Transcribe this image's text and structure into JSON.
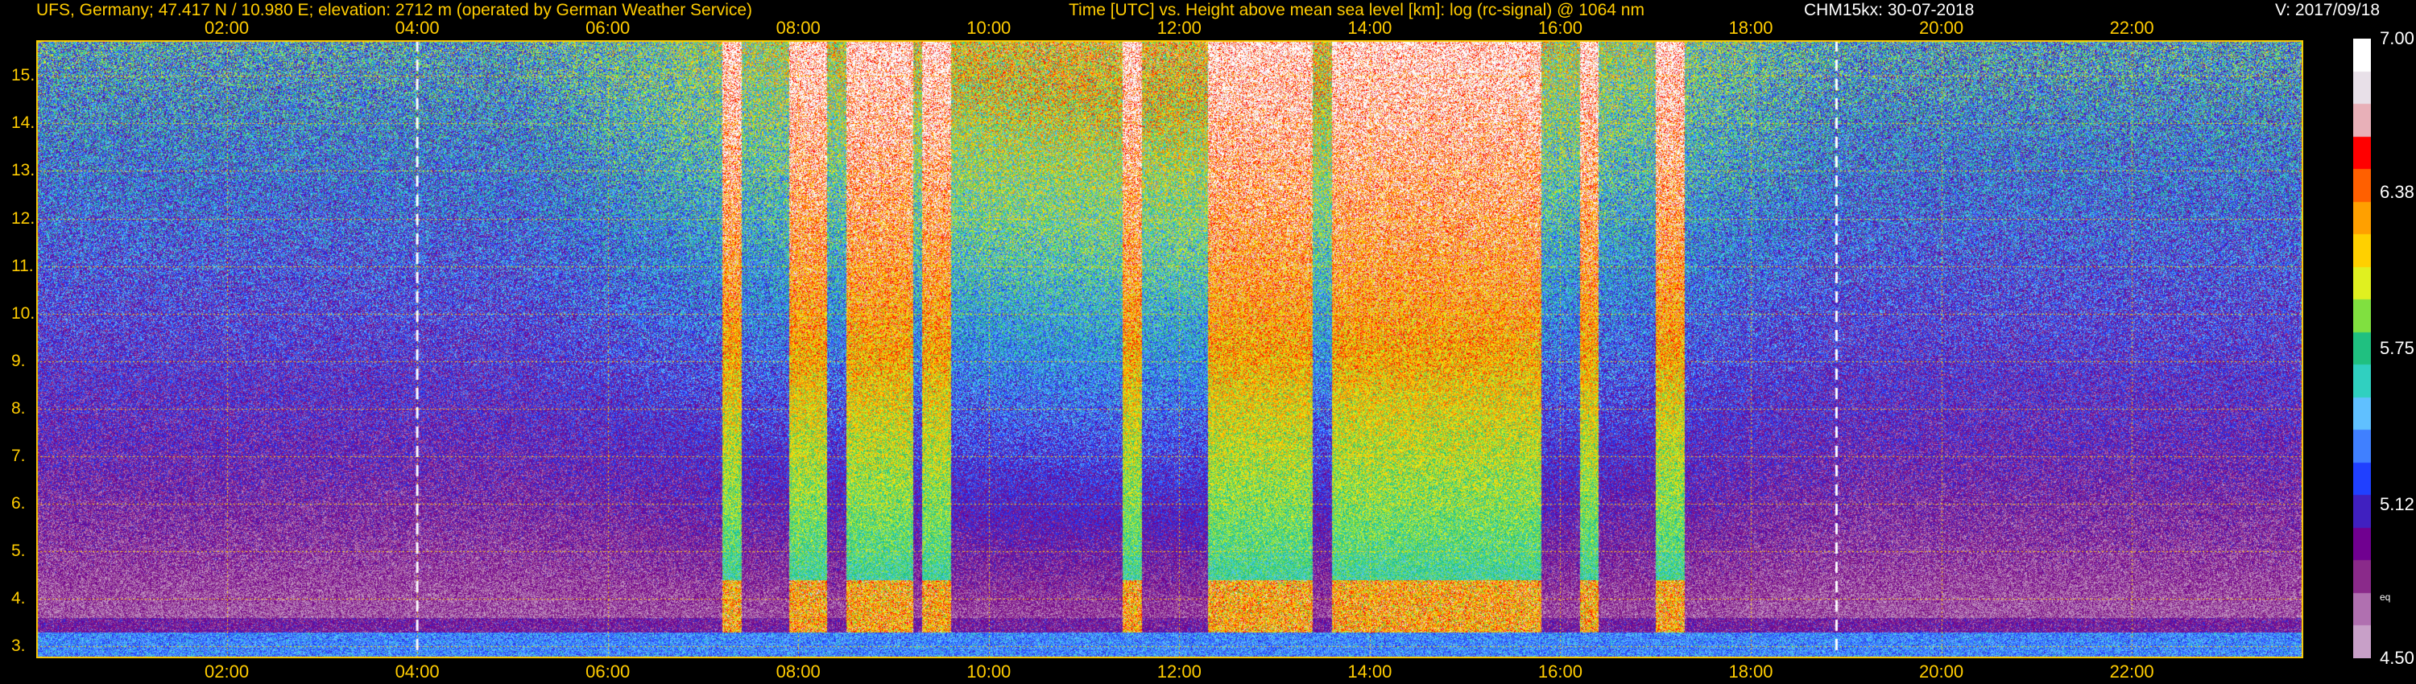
{
  "header": {
    "site": "UFS, Germany; 47.417 N / 10.980 E; elevation: 2712 m  (operated by German Weather Service)",
    "title": "Time [UTC] vs. Height above mean sea level [km]: log (rc-signal) @ 1064 nm",
    "instrument": "CHM15kx: 30-07-2018",
    "version": "V: 2017/09/18"
  },
  "chart_data": {
    "type": "heatmap",
    "title": "Time [UTC] vs. Height above mean sea level [km]: log (rc-signal) @ 1064 nm",
    "x_ticks": [
      "02:00",
      "04:00",
      "06:00",
      "08:00",
      "10:00",
      "12:00",
      "14:00",
      "16:00",
      "18:00",
      "20:00",
      "22:00"
    ],
    "x_tick_hours": [
      2,
      4,
      6,
      8,
      10,
      12,
      14,
      16,
      18,
      20,
      22
    ],
    "xlim_hours": [
      0.0,
      23.8
    ],
    "y_ticks": [
      "3.",
      "4.",
      "5.",
      "6.",
      "7.",
      "8.",
      "9.",
      "10.",
      "11.",
      "12.",
      "13.",
      "14.",
      "15."
    ],
    "y_tick_values": [
      3,
      4,
      5,
      6,
      7,
      8,
      9,
      10,
      11,
      12,
      13,
      14,
      15
    ],
    "ylim": [
      2.75,
      15.75
    ],
    "dashed_markers_hours": [
      4.0,
      18.9
    ],
    "colorbar": {
      "labels": [
        "7.00",
        "6.38",
        "5.75",
        "5.12",
        "4.50"
      ],
      "values": [
        7.0,
        6.38,
        5.75,
        5.12,
        4.5
      ],
      "range": [
        4.5,
        7.0
      ],
      "note": "eq",
      "colors": [
        "#ffffff",
        "#e8e0e8",
        "#e8b0b8",
        "#ff0000",
        "#ff6000",
        "#ffa000",
        "#ffd000",
        "#e0f020",
        "#80e040",
        "#20c080",
        "#30d0c0",
        "#60c0ff",
        "#4080ff",
        "#2040ff",
        "#4020c0",
        "#700090",
        "#8a2a8a",
        "#b070b0",
        "#c8a0c8"
      ]
    },
    "grid": true,
    "grid_color": "#ffcc00"
  }
}
